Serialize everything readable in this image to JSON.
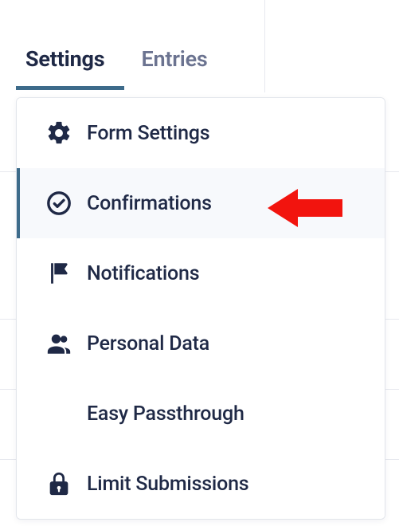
{
  "header": {
    "tabs": [
      {
        "id": "settings",
        "label": "Settings",
        "active": true
      },
      {
        "id": "entries",
        "label": "Entries",
        "active": false
      }
    ]
  },
  "menu": {
    "items": [
      {
        "id": "form-settings",
        "icon": "gear-icon",
        "label": "Form Settings",
        "selected": false
      },
      {
        "id": "confirmations",
        "icon": "check-circle-icon",
        "label": "Confirmations",
        "selected": true
      },
      {
        "id": "notifications",
        "icon": "flag-icon",
        "label": "Notifications",
        "selected": false
      },
      {
        "id": "personal-data",
        "icon": "people-icon",
        "label": "Personal Data",
        "selected": false
      },
      {
        "id": "easy-passthrough",
        "icon": "",
        "label": "Easy Passthrough",
        "selected": false
      },
      {
        "id": "limit-submissions",
        "icon": "lock-icon",
        "label": "Limit Submissions",
        "selected": false
      }
    ]
  },
  "annotation": {
    "type": "arrow-left",
    "color": "#f2140e",
    "target": "confirmations"
  },
  "colors": {
    "text": "#1f2946",
    "muted": "#6b7390",
    "accent": "#3d6b8a",
    "selected_bg": "#f7f9fc",
    "panel_border": "#e2e5eb",
    "arrow": "#f2140e"
  }
}
